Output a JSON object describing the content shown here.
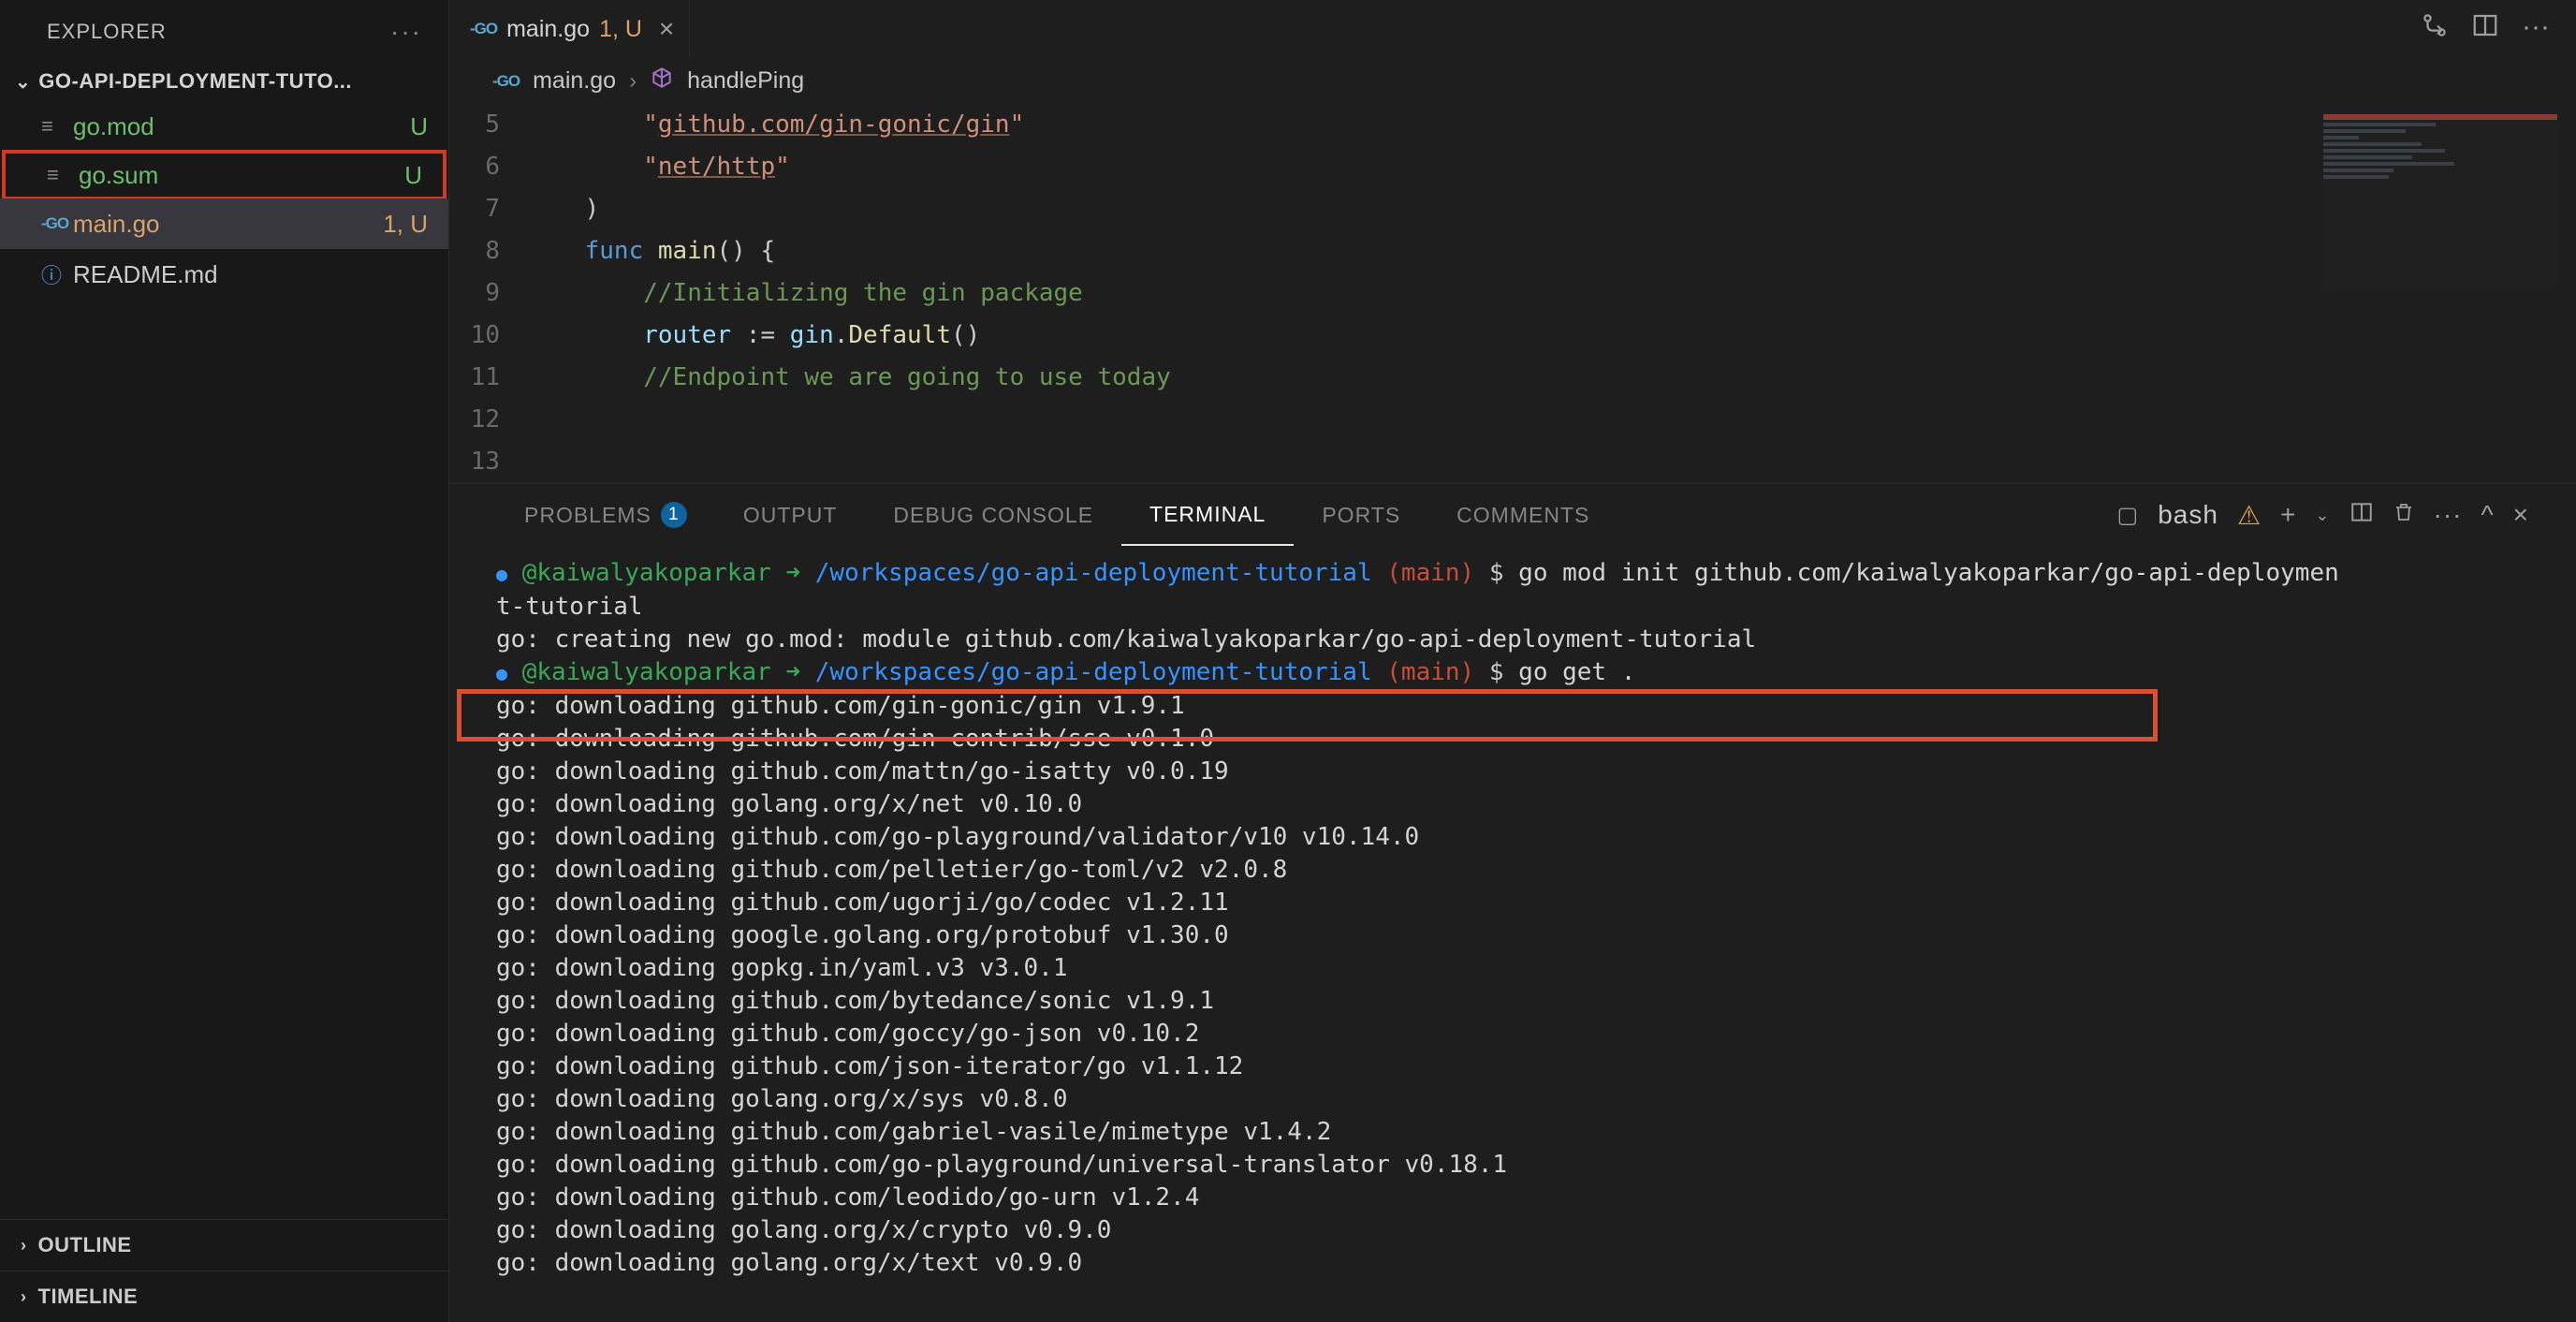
{
  "sidebar": {
    "title": "EXPLORER",
    "project_name": "GO-API-DEPLOYMENT-TUTO...",
    "files": [
      {
        "name": "go.mod",
        "badge": "U",
        "style": "green",
        "icon_type": "line"
      },
      {
        "name": "go.sum",
        "badge": "U",
        "style": "green",
        "icon_type": "line",
        "red_box": true
      },
      {
        "name": "main.go",
        "badge": "1, U",
        "style": "orange",
        "icon_type": "go"
      },
      {
        "name": "README.md",
        "badge": "",
        "style": "",
        "icon_type": "readme"
      }
    ],
    "sections": [
      "OUTLINE",
      "TIMELINE"
    ]
  },
  "tab": {
    "file": "main.go",
    "marker": "1, U"
  },
  "breadcrumbs": {
    "file": "main.go",
    "symbol": "handlePing"
  },
  "code": {
    "lines": [
      {
        "num": "5",
        "indent": "        ",
        "tokens": [
          {
            "t": "str",
            "v": "\""
          },
          {
            "t": "str-u",
            "v": "github.com/gin-gonic/gin"
          },
          {
            "t": "str",
            "v": "\""
          }
        ]
      },
      {
        "num": "6",
        "indent": "        ",
        "tokens": [
          {
            "t": "str",
            "v": "\""
          },
          {
            "t": "str-u",
            "v": "net/http"
          },
          {
            "t": "str",
            "v": "\""
          }
        ]
      },
      {
        "num": "7",
        "indent": "    ",
        "tokens": [
          {
            "t": "",
            "v": ")"
          }
        ]
      },
      {
        "num": "8",
        "indent": "",
        "tokens": []
      },
      {
        "num": "9",
        "indent": "    ",
        "tokens": [
          {
            "t": "kw",
            "v": "func"
          },
          {
            "t": "",
            "v": " "
          },
          {
            "t": "fn",
            "v": "main"
          },
          {
            "t": "",
            "v": "() {"
          }
        ]
      },
      {
        "num": "10",
        "indent": "        ",
        "tokens": [
          {
            "t": "cmt",
            "v": "//Initializing the gin package"
          }
        ]
      },
      {
        "num": "11",
        "indent": "        ",
        "tokens": [
          {
            "t": "var",
            "v": "router"
          },
          {
            "t": "",
            "v": " := "
          },
          {
            "t": "var",
            "v": "gin"
          },
          {
            "t": "",
            "v": "."
          },
          {
            "t": "fn",
            "v": "Default"
          },
          {
            "t": "",
            "v": "()"
          }
        ]
      },
      {
        "num": "12",
        "indent": "",
        "tokens": []
      },
      {
        "num": "13",
        "indent": "        ",
        "tokens": [
          {
            "t": "cmt",
            "v": "//Endpoint we are going to use today"
          }
        ]
      }
    ]
  },
  "panel": {
    "tabs": [
      {
        "label": "PROBLEMS",
        "count": "1"
      },
      {
        "label": "OUTPUT"
      },
      {
        "label": "DEBUG CONSOLE"
      },
      {
        "label": "TERMINAL",
        "active": true
      },
      {
        "label": "PORTS"
      },
      {
        "label": "COMMENTS"
      }
    ],
    "shell": "bash"
  },
  "terminal_lines": [
    {
      "type": "prompt_wrapped",
      "user": "@kaiwalyakoparkar",
      "path": "/workspaces/go-api-deployment-tutorial",
      "branch": "main",
      "cmd": "go mod init github.com/kaiwalyakoparkar/go-api-deploymen",
      "wrap": "t-tutorial"
    },
    {
      "type": "plain",
      "text": "go: creating new go.mod: module github.com/kaiwalyakoparkar/go-api-deployment-tutorial"
    },
    {
      "type": "prompt",
      "user": "@kaiwalyakoparkar",
      "path": "/workspaces/go-api-deployment-tutorial",
      "branch": "main",
      "cmd": "go get ."
    },
    {
      "type": "plain",
      "text": "go: downloading github.com/gin-gonic/gin v1.9.1"
    },
    {
      "type": "plain",
      "text": "go: downloading github.com/gin-contrib/sse v0.1.0"
    },
    {
      "type": "plain",
      "text": "go: downloading github.com/mattn/go-isatty v0.0.19"
    },
    {
      "type": "plain",
      "text": "go: downloading golang.org/x/net v0.10.0"
    },
    {
      "type": "plain",
      "text": "go: downloading github.com/go-playground/validator/v10 v10.14.0"
    },
    {
      "type": "plain",
      "text": "go: downloading github.com/pelletier/go-toml/v2 v2.0.8"
    },
    {
      "type": "plain",
      "text": "go: downloading github.com/ugorji/go/codec v1.2.11"
    },
    {
      "type": "plain",
      "text": "go: downloading google.golang.org/protobuf v1.30.0"
    },
    {
      "type": "plain",
      "text": "go: downloading gopkg.in/yaml.v3 v3.0.1"
    },
    {
      "type": "plain",
      "text": "go: downloading github.com/bytedance/sonic v1.9.1"
    },
    {
      "type": "plain",
      "text": "go: downloading github.com/goccy/go-json v0.10.2"
    },
    {
      "type": "plain",
      "text": "go: downloading github.com/json-iterator/go v1.1.12"
    },
    {
      "type": "plain",
      "text": "go: downloading golang.org/x/sys v0.8.0"
    },
    {
      "type": "plain",
      "text": "go: downloading github.com/gabriel-vasile/mimetype v1.4.2"
    },
    {
      "type": "plain",
      "text": "go: downloading github.com/go-playground/universal-translator v0.18.1"
    },
    {
      "type": "plain",
      "text": "go: downloading github.com/leodido/go-urn v1.2.4"
    },
    {
      "type": "plain",
      "text": "go: downloading golang.org/x/crypto v0.9.0"
    },
    {
      "type": "plain",
      "text": "go: downloading golang.org/x/text v0.9.0"
    }
  ]
}
